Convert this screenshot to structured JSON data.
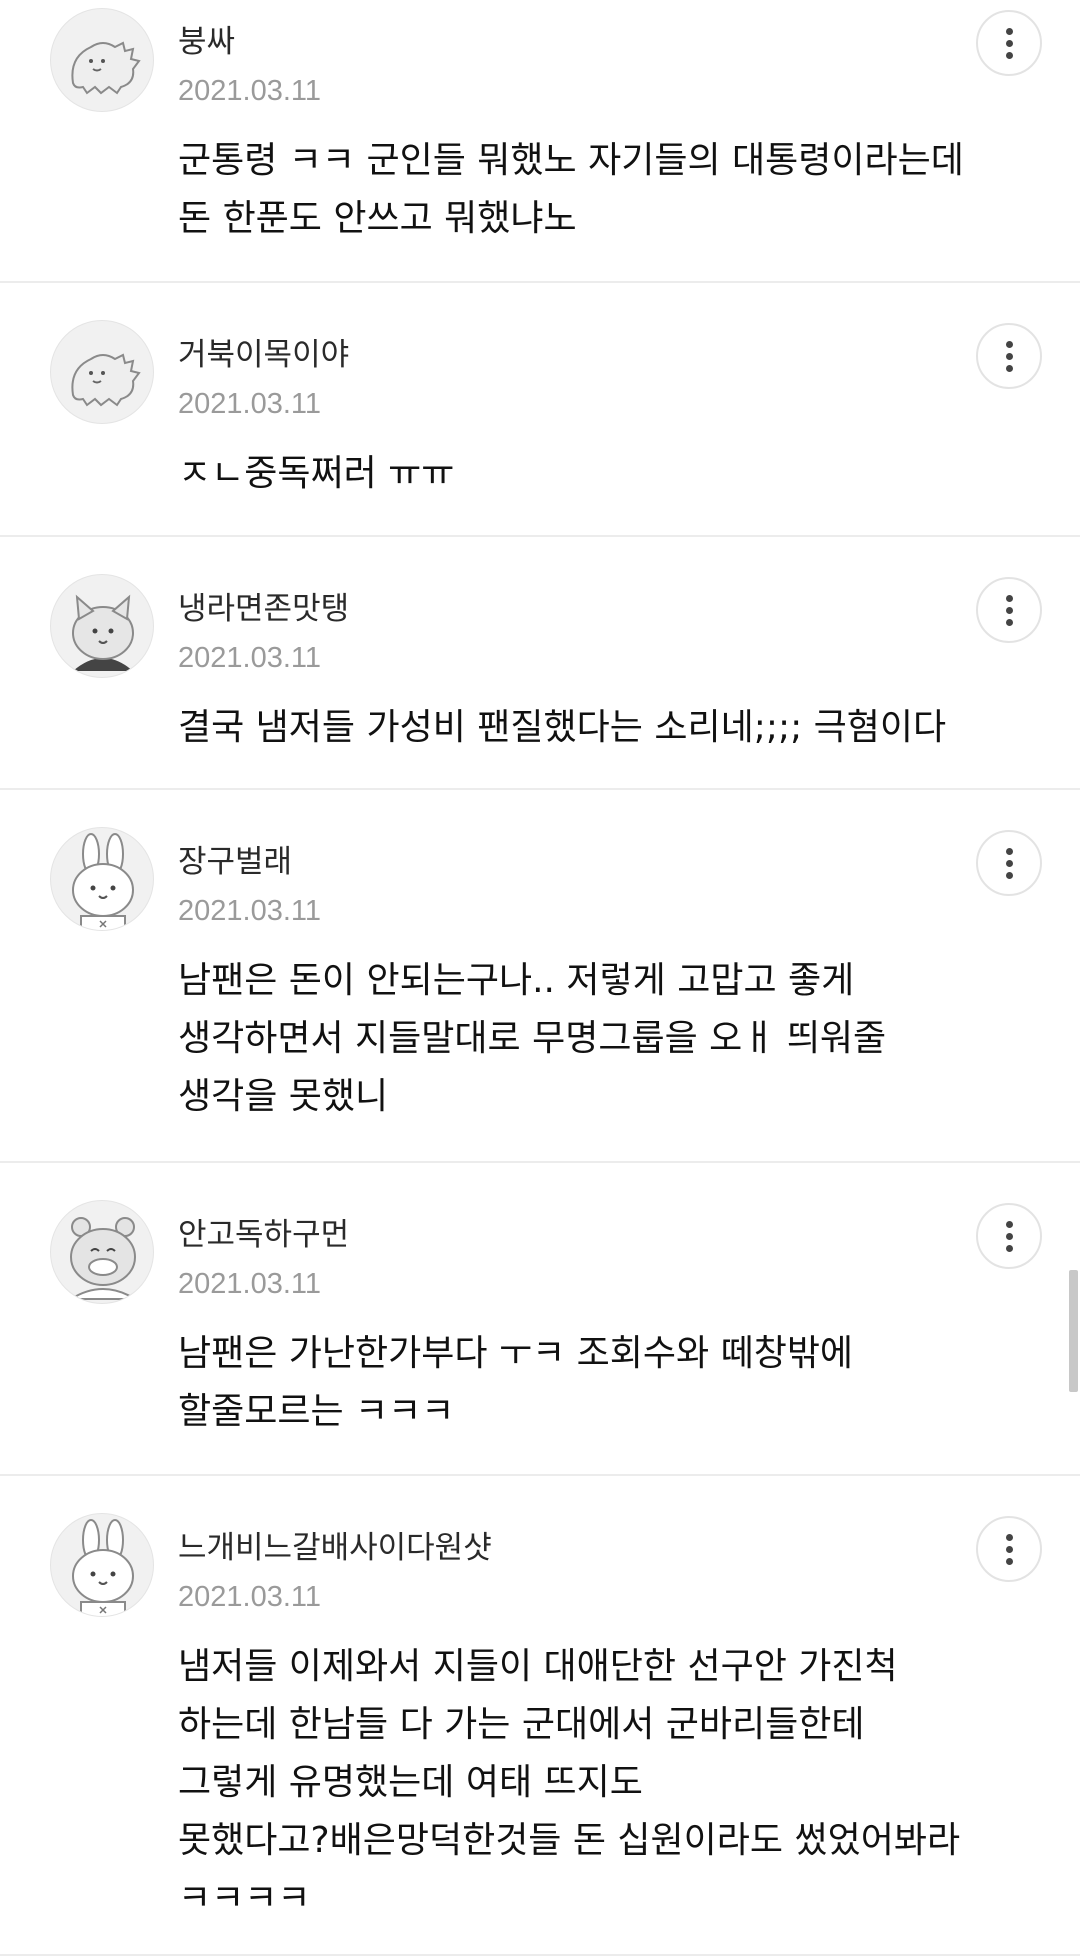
{
  "comments": [
    {
      "name": "붕싸",
      "date": "2021.03.11",
      "text": "군통령 ㅋㅋ 군인들 뭐했노 자기들의 대통령이라는데\n돈 한푼도 안쓰고 뭐했냐노",
      "avatar": "dinosaur-avatar-icon"
    },
    {
      "name": "거북이목이야",
      "date": "2021.03.11",
      "text": "ㅈㄴ중독쩌러 ㅠㅠ",
      "avatar": "dinosaur-avatar-icon"
    },
    {
      "name": "냉라면존맛탱",
      "date": "2021.03.11",
      "text": "결국 냄저들 가성비 팬질했다는 소리네;;;; 극혐이다",
      "avatar": "cat-avatar-icon"
    },
    {
      "name": "장구벌래",
      "date": "2021.03.11",
      "text": "남팬은 돈이 안되는구나.. 저렇게 고맙고 좋게\n생각하면서 지들말대로 무명그룹을 오ㅐ 띄워줄\n생각을 못했니",
      "avatar": "rabbit-avatar-icon"
    },
    {
      "name": "안고독하구먼",
      "date": "2021.03.11",
      "text": "남팬은 가난한가부다 ㅜㅋ 조회수와 떼창밖에\n할줄모르는 ㅋㅋㅋ",
      "avatar": "bear-avatar-icon"
    },
    {
      "name": "느개비느갈배사이다원샷",
      "date": "2021.03.11",
      "text": "냄저들 이제와서 지들이 대애단한 선구안 가진척\n하는데 한남들 다 가는 군대에서 군바리들한테\n그렇게 유명했는데 여태 뜨지도\n못했다고?배은망덕한것들 돈 십원이라도 썼었어봐라\nㅋㅋㅋㅋ",
      "avatar": "rabbit-avatar-icon"
    }
  ],
  "icons": {
    "more": "more-vertical-icon"
  },
  "colors": {
    "name": "#2a2a2a",
    "date": "#9a9a9a",
    "text": "#111111",
    "divider": "#ececec"
  }
}
